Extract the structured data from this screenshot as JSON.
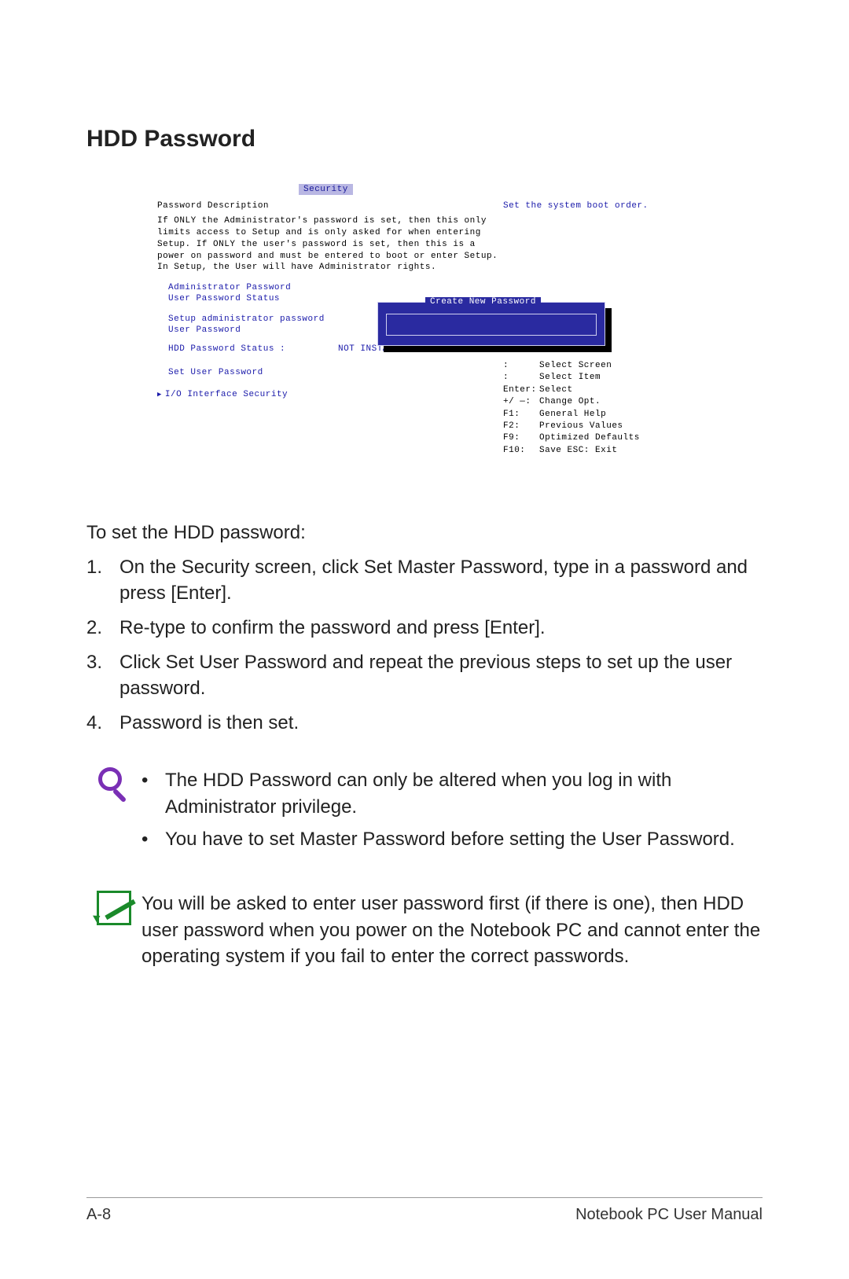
{
  "title": "HDD Password",
  "bios": {
    "tab": "Security",
    "desc_title": "Password Description",
    "desc": "If ONLY the Administrator's password is set, then this only limits access to Setup and is only asked for when entering Setup. If ONLY the user's password is set, then this is a power on password and must be entered to boot or enter Setup. In Setup, the User will have Administrator rights.",
    "help_right": "Set the system boot order.",
    "items": {
      "admin_pw": "Administrator Password",
      "user_pw_status": "User Password Status",
      "setup_admin_pw": "Setup administrator password",
      "user_pw": "User Password",
      "hdd_status_label": "HDD Password Status :",
      "hdd_status_value": "NOT INSTALLED",
      "set_user_pw": "Set User Password",
      "io_interface": "I/O Interface Security"
    },
    "popup_title": "Create New Password",
    "keys": [
      {
        "k": " :",
        "v": "Select Screen"
      },
      {
        "k": "  :",
        "v": "Select Item"
      },
      {
        "k": "Enter:",
        "v": "Select"
      },
      {
        "k": "+/ —:",
        "v": "Change Opt."
      },
      {
        "k": "F1:",
        "v": "General Help"
      },
      {
        "k": "F2:",
        "v": "Previous Values"
      },
      {
        "k": "F9:",
        "v": "Optimized Defaults"
      },
      {
        "k": "F10:",
        "v": "Save   ESC: Exit"
      }
    ]
  },
  "instructions": {
    "intro": "To set the HDD password:",
    "steps": [
      "On the Security screen, click Set Master Password, type in a password and press [Enter].",
      "Re-type to confirm the password and press [Enter].",
      "Click Set User Password and repeat the previous steps to set up the user password.",
      "Password is then set."
    ]
  },
  "note1": {
    "bullets": [
      "The HDD Password can only be altered when you log in with Administrator privilege.",
      "You have to set Master Password before setting the User Password."
    ]
  },
  "note2": {
    "text": "You will be asked to enter user password first (if there is one), then HDD user password when you power on the Notebook PC and cannot enter the operating system if you fail to enter the correct passwords."
  },
  "footer": {
    "left": "A-8",
    "right": "Notebook PC User Manual"
  }
}
